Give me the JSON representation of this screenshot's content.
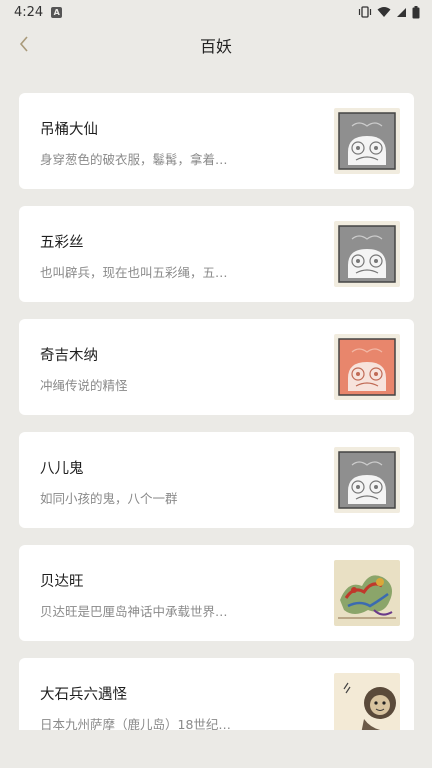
{
  "status_bar": {
    "time": "4:24"
  },
  "header": {
    "title": "百妖"
  },
  "items": [
    {
      "name": "吊桶大仙",
      "desc": "身穿葱色的破衣服，鬈髯，拿着…",
      "thumb": "gray-placeholder"
    },
    {
      "name": "五彩丝",
      "desc": "也叫辟兵，现在也叫五彩绳，五…",
      "thumb": "gray-placeholder"
    },
    {
      "name": "奇吉木纳",
      "desc": "冲绳传说的精怪",
      "thumb": "red-placeholder"
    },
    {
      "name": "八儿鬼",
      "desc": "如同小孩的鬼，八个一群",
      "thumb": "gray-placeholder"
    },
    {
      "name": "贝达旺",
      "desc": "贝达旺是巴厘岛神话中承载世界…",
      "thumb": "colorful-dragon-art"
    },
    {
      "name": "大石兵六遇怪",
      "desc": "日本九州萨摩（鹿儿岛）18世纪…",
      "thumb": "monkey-ink-art"
    }
  ],
  "colors": {
    "background": "#ebeae6",
    "card": "#ffffff",
    "back_arrow": "#a99a7a",
    "placeholder_gray": "#8f8f8f",
    "placeholder_red": "#e8866c",
    "thumb_frame": "#f1ecdf"
  }
}
